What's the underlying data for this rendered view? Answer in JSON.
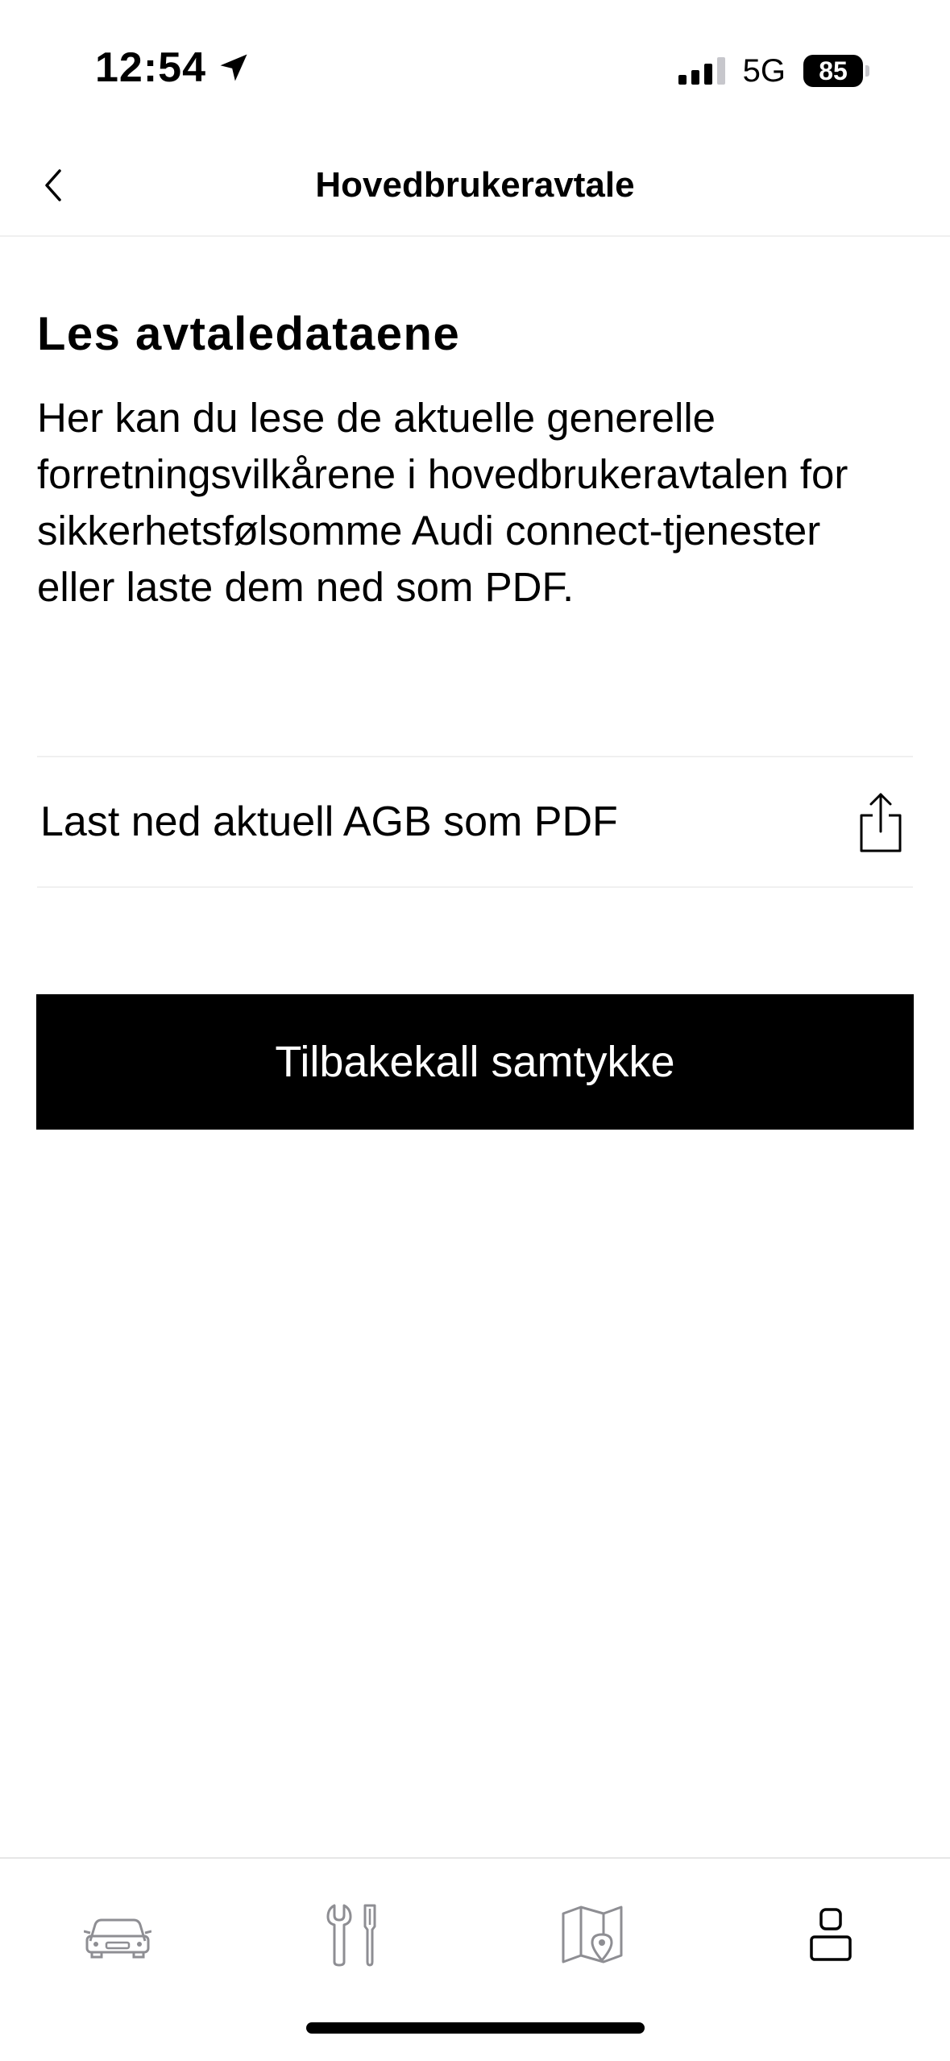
{
  "status_bar": {
    "time": "12:54",
    "network": "5G",
    "battery": "85",
    "location_icon": "location-arrow-icon",
    "signal_icon": "cellular-signal-icon"
  },
  "nav": {
    "title": "Hovedbrukeravtale",
    "back_icon": "chevron-left-icon"
  },
  "main": {
    "heading": "Les avtaledataene",
    "intro": "Her kan du lese de aktuelle generelle forretningsvilkårene i hovedbrukeravtalen for sikkerhetsfølsomme Audi connect-tjenester eller laste dem ned som PDF.",
    "download": {
      "label": "Last ned aktuell AGB som PDF",
      "icon": "share-icon"
    },
    "revoke_button": "Tilbakekall samtykke"
  },
  "tab_bar": {
    "tabs": [
      {
        "icon": "car-icon",
        "active": false
      },
      {
        "icon": "tools-icon",
        "active": false
      },
      {
        "icon": "map-icon",
        "active": false
      },
      {
        "icon": "profile-icon",
        "active": true
      }
    ]
  },
  "colors": {
    "primary": "#000000",
    "background": "#ffffff",
    "inactive_icon": "#8e8e93",
    "divider": "#f0f0f0"
  }
}
